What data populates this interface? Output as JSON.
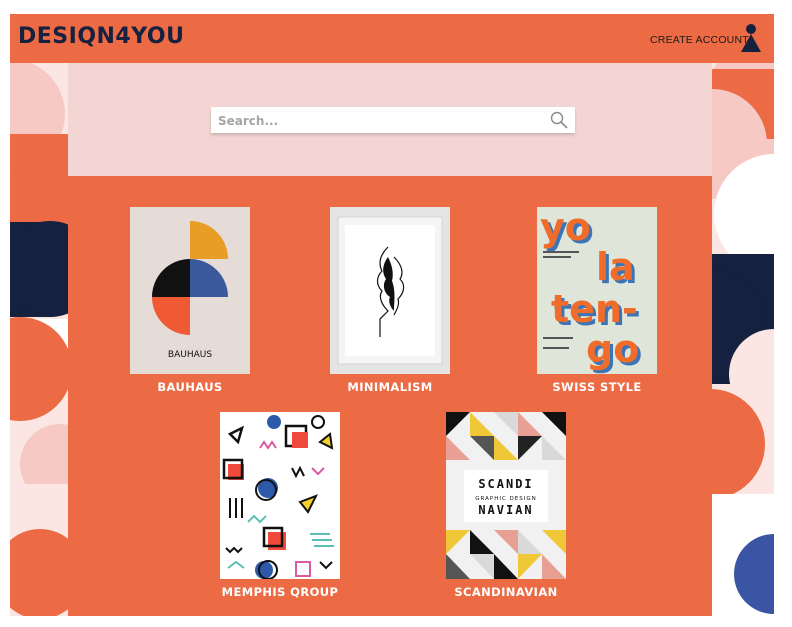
{
  "header": {
    "logo": "DESIQN4YOU",
    "create_account": "CREATE ACCOUNT"
  },
  "search": {
    "placeholder": "Search..."
  },
  "cards": [
    {
      "label": "BAUHAUS",
      "poster_text": "BAUHAUS"
    },
    {
      "label": "MINIMALISM"
    },
    {
      "label": "SWISS STYLE",
      "poster_words": [
        "yo",
        "la",
        "ten-",
        "go"
      ]
    },
    {
      "label": "MEMPHIS QROUP"
    },
    {
      "label": "SCANDINAVIAN",
      "poster_lines": [
        "SCANDI",
        "GRAPHIC DESIGN",
        "NAVIAN"
      ]
    }
  ],
  "colors": {
    "brand_orange": "#ec6a44",
    "navy": "#15213f",
    "pink": "#f6d9d6"
  }
}
